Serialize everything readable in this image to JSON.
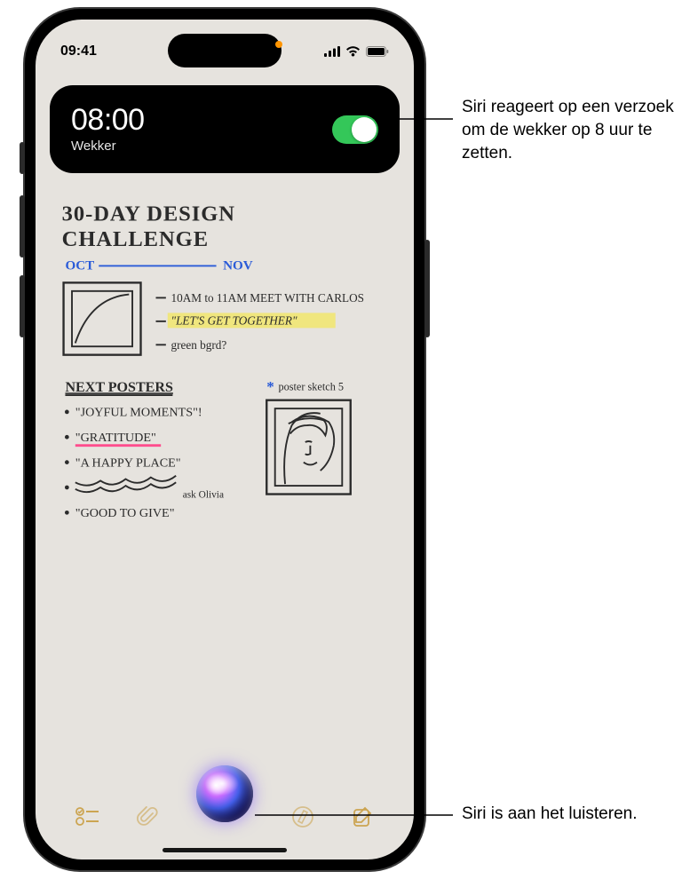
{
  "status": {
    "time": "09:41"
  },
  "notification": {
    "time": "08:00",
    "label": "Wekker"
  },
  "note": {
    "title_line1": "30-DAY DESIGN",
    "title_line2": "CHALLENGE",
    "month_start": "OCT",
    "month_end": "NOV",
    "bullet1": "10AM to 11AM MEET WITH CARLOS",
    "bullet2": "\"LET'S GET TOGETHER\"",
    "bullet3": "green bgrd?",
    "section_header": "NEXT POSTERS",
    "poster1": "\"JOYFUL MOMENTS\"!",
    "poster2": "\"GRATITUDE\"",
    "poster3": "\"A HAPPY PLACE\"",
    "poster4_note": "ask Olivia",
    "poster5": "\"GOOD TO GIVE\"",
    "sketch_label": "poster sketch 5"
  },
  "callouts": {
    "alarm": "Siri reageert op een verzoek om de wekker op 8 uur te zetten.",
    "listening": "Siri is aan het luisteren."
  }
}
